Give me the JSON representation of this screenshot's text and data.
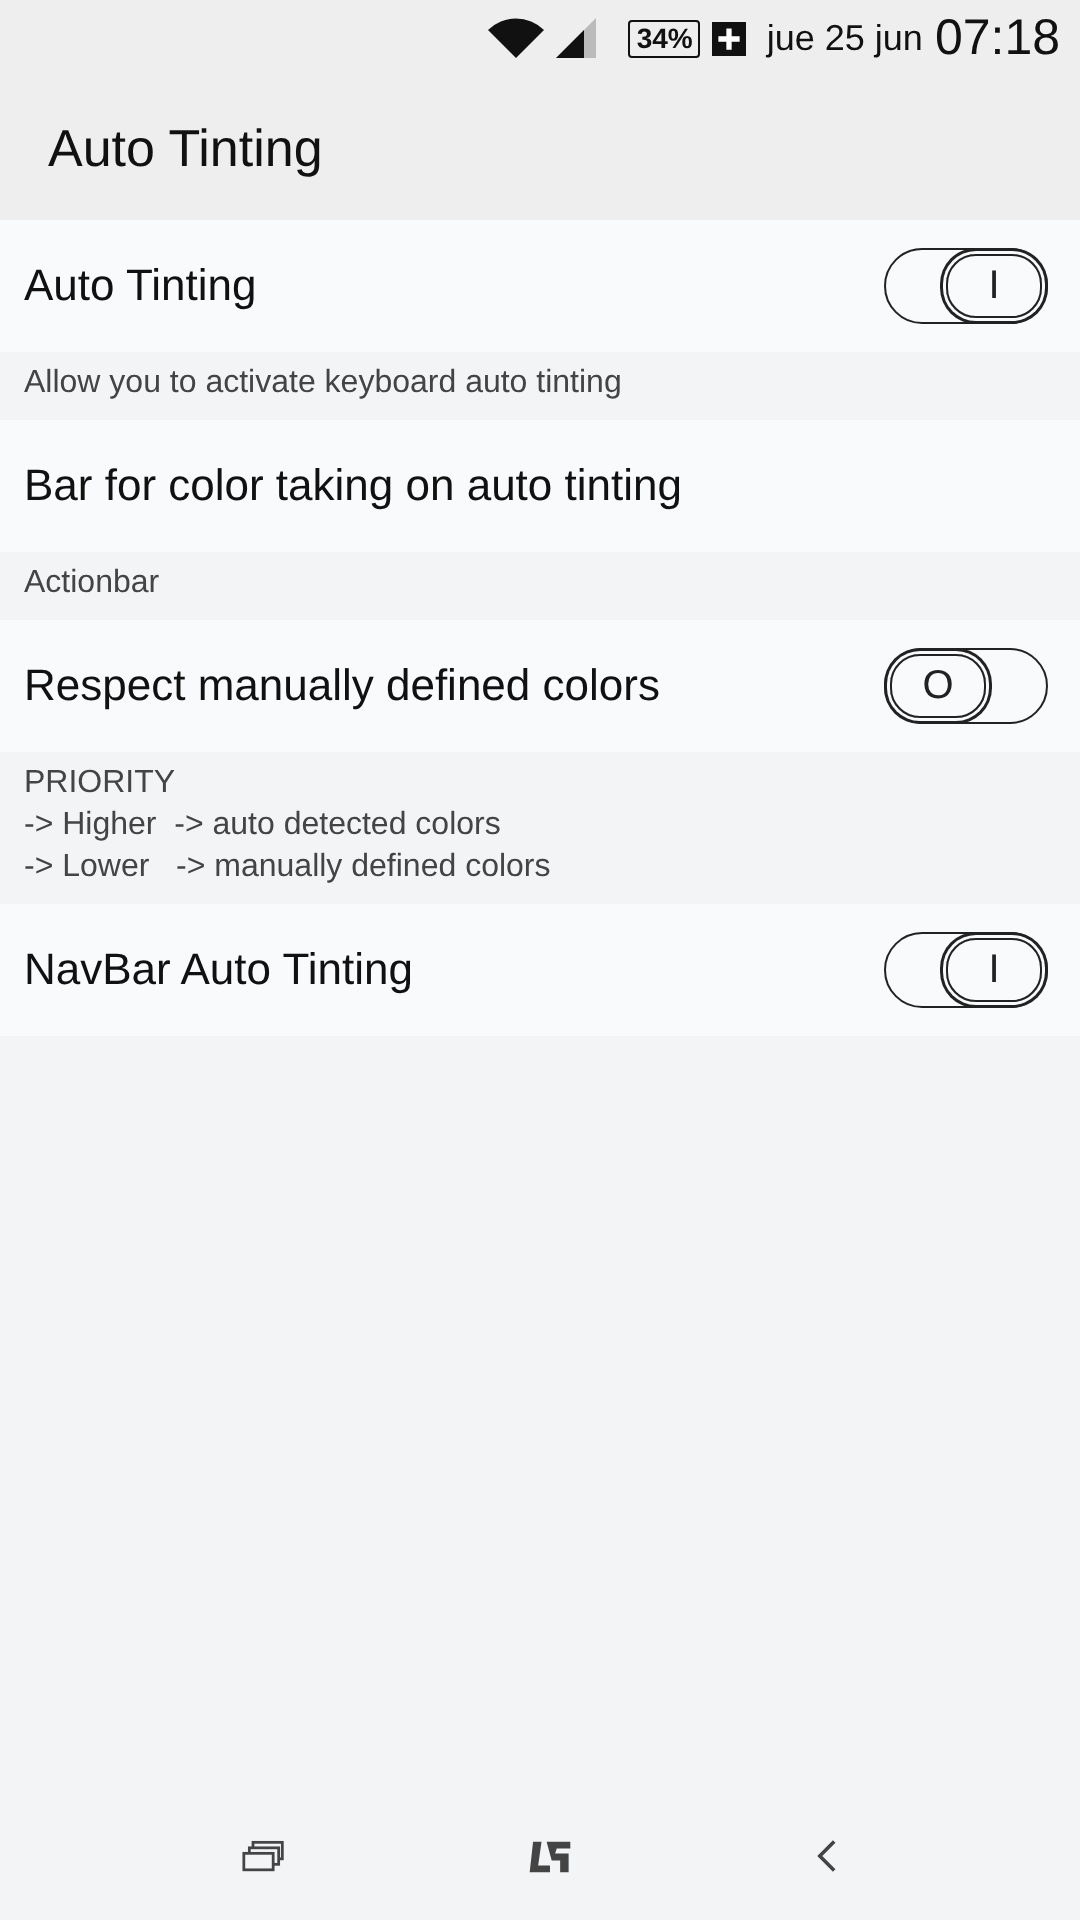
{
  "status_bar": {
    "battery": "34%",
    "charging": true,
    "date": "jue 25 jun",
    "time": "07:18"
  },
  "action_bar": {
    "title": "Auto Tinting"
  },
  "settings": [
    {
      "kind": "toggle",
      "title": "Auto Tinting",
      "on": true,
      "glyph": "I",
      "description": [
        "Allow you to activate keyboard auto tinting"
      ]
    },
    {
      "kind": "text",
      "title": "Bar for color taking on auto tinting",
      "description": [
        "Actionbar"
      ]
    },
    {
      "kind": "toggle",
      "title": "Respect manually defined colors",
      "on": false,
      "glyph": "O",
      "description": [
        "PRIORITY",
        "-> Higher  -> auto detected colors",
        "-> Lower   -> manually defined colors"
      ]
    },
    {
      "kind": "toggle",
      "title": "NavBar Auto Tinting",
      "on": true,
      "glyph": "I"
    }
  ]
}
